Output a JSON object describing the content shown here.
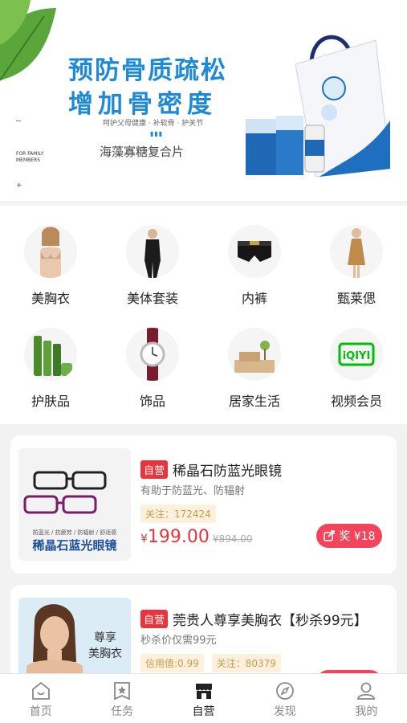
{
  "banner": {
    "title_line1": "预防骨质疏松",
    "title_line2": "增加骨密度",
    "subtitle": "呵护父母健康 · 补软骨 · 护关节",
    "product_name": "海藻寡糖复合片",
    "family_text": "FOR FAMILY MEMBERS",
    "plus": "+"
  },
  "categories": [
    {
      "label": "美胸衣",
      "icon": "bra-model-image"
    },
    {
      "label": "美体套装",
      "icon": "shapewear-image"
    },
    {
      "label": "内裤",
      "icon": "underwear-image"
    },
    {
      "label": "甄莱偲",
      "icon": "dress-model-image"
    },
    {
      "label": "护肤品",
      "icon": "skincare-image"
    },
    {
      "label": "饰品",
      "icon": "watch-image"
    },
    {
      "label": "居家生活",
      "icon": "home-image"
    },
    {
      "label": "视频会员",
      "icon": "iqiyi-logo"
    }
  ],
  "products": [
    {
      "tag": "自营",
      "title": "稀晶石防蓝光眼镜",
      "desc": "有助于防蓝光、防辐射",
      "follow": "关注：172424",
      "price_symbol": "¥",
      "price": "199.00",
      "orig_price": "¥894.00",
      "reward": "奖 ¥18",
      "thumb_caption_small": "防蓝光 / 抗疲劳 / 防辐射 / 舒适感",
      "thumb_caption_big": "稀晶石蓝光眼镜"
    },
    {
      "tag": "自营",
      "title": "莞贵人尊享美胸衣【秒杀99元】",
      "desc": "秒杀价仅需99元",
      "credit": "信用值:0.99",
      "follow": "关注：80379",
      "thumb_caption": "尊享\n美胸衣"
    }
  ],
  "tabs": [
    {
      "label": "首页",
      "icon": "home-icon"
    },
    {
      "label": "任务",
      "icon": "task-star-icon"
    },
    {
      "label": "自营",
      "icon": "shop-icon"
    },
    {
      "label": "发现",
      "icon": "compass-icon"
    },
    {
      "label": "我的",
      "icon": "user-icon"
    }
  ],
  "colors": {
    "accent": "#e8343a",
    "reward": "#f2455c",
    "banner_blue": "#1e8ad6"
  }
}
